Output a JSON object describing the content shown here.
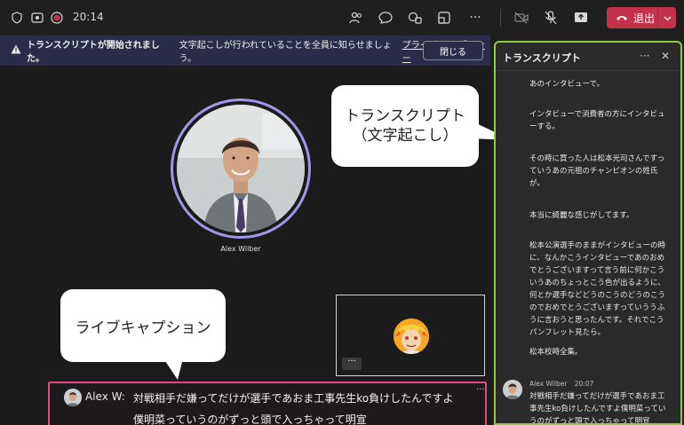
{
  "topbar": {
    "time": "20:14",
    "leave_label": "退出",
    "icons": [
      "shield-icon",
      "record-status-icon",
      "recording-dot-icon",
      "people-icon",
      "chat-icon",
      "reactions-icon",
      "share-view-icon",
      "more-icon",
      "camera-off-icon",
      "mic-off-icon",
      "share-screen-icon",
      "phone-icon",
      "chevron-down-icon"
    ],
    "colors": {
      "leave": "#c4314b",
      "recording": "#c4314b"
    }
  },
  "banner": {
    "title": "トランスクリプトが開始されました。",
    "message": "文字起こしが行われていることを全員に知らせましょう。",
    "link": "プライバシー ポリシー",
    "close_label": "閉じる"
  },
  "stage": {
    "participant_name": "Alex Wilber",
    "callout_transcript_line1": "トランスクリプト",
    "callout_transcript_line2": "（文字起こし）",
    "callout_livecaption": "ライブキャプション",
    "self_more": "···"
  },
  "caption": {
    "speaker": "Alex W:",
    "line1": "対戦相手だ嫌ってだけが選手であおま工事先生ko負けしたんですよ",
    "line2": "僕明菜っていうのがずっと頭で入っちゃって明宣",
    "more": "···"
  },
  "transcript": {
    "title": "トランスクリプト",
    "more": "···",
    "close": "✕",
    "paragraphs": [
      "あのインタビューで。",
      "インタビューで消費者の方にインタビューする。",
      "その時に買った人は松本光司さんですっていうあの元祖のチャンピオンの姓氏が。",
      "本当に綺麗な感じがしてます。",
      "松本公演選手のままがインタビューの時に、なんかこうインタビューであのおめでとうございますって言う前に何かこういうあのちょっとこう色が出るように、何とか選手などどうのこうのどうのこうのでおめでとうございますっていううふうに言おうと思ったんです。それでこうパンフレット見たら。",
      "松本校時全集。"
    ],
    "entry": {
      "speaker": "Alex Wilber",
      "time": "20:07",
      "text": "対戦相手だ嫌ってだけが選手であおま工事先生ko負けしたんですよ僕明菜っていうのがずっと頭で入っちゃって明宣"
    }
  }
}
